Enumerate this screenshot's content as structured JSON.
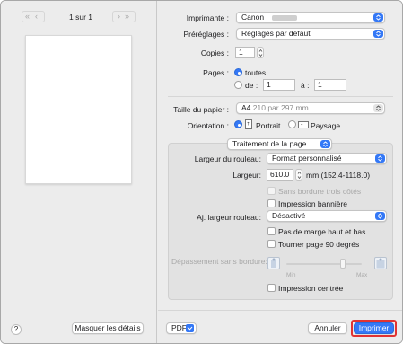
{
  "preview": {
    "page_indicator": "1 sur 1",
    "hide_details_label": "Masquer les détails",
    "help_label": "?"
  },
  "form": {
    "printer": {
      "label": "Imprimante :",
      "value": "Canon"
    },
    "presets": {
      "label": "Préréglages :",
      "value": "Réglages par défaut"
    },
    "copies": {
      "label": "Copies :",
      "value": "1"
    },
    "pages": {
      "label": "Pages :",
      "all_label": "toutes",
      "from_label": "de :",
      "from_value": "1",
      "to_label": "à :",
      "to_value": "1",
      "selected": "all"
    },
    "paper_size": {
      "label": "Taille du papier :",
      "value": "A4",
      "detail": "210 par 297 mm"
    },
    "orientation": {
      "label": "Orientation :",
      "portrait_label": "Portrait",
      "landscape_label": "Paysage",
      "selected": "portrait"
    },
    "section_popup": {
      "value": "Traitement de la page"
    }
  },
  "page_processing": {
    "roll_width": {
      "label": "Largeur du rouleau:",
      "value": "Format personnalisé"
    },
    "width": {
      "label": "Largeur:",
      "value": "610.0",
      "units": "mm (152.4-1118.0)"
    },
    "borderless_three_sides": {
      "label": "Sans bordure trois côtés",
      "checked": false,
      "enabled": false
    },
    "banner_print": {
      "label": "Impression bannière",
      "checked": false,
      "enabled": true
    },
    "adjust_roll_width": {
      "label": "Aj. largeur rouleau:",
      "value": "Désactivé"
    },
    "no_top_bottom_margin": {
      "label": "Pas de marge haut et bas",
      "checked": false,
      "enabled": true
    },
    "rotate_page_90": {
      "label": "Tourner page 90 degrés",
      "checked": false,
      "enabled": true
    },
    "borderless_extension": {
      "label": "Dépassement sans bordure:",
      "min_label": "Min",
      "max_label": "Max",
      "level": 0.75,
      "enabled": false
    },
    "centered_print": {
      "label": "Impression centrée",
      "checked": false,
      "enabled": true
    }
  },
  "footer": {
    "pdf_label": "PDF",
    "cancel_label": "Annuler",
    "print_label": "Imprimer"
  },
  "colors": {
    "accent": "#3478f6",
    "window_bg": "#ececec",
    "group_bg": "#e2e2e2"
  }
}
